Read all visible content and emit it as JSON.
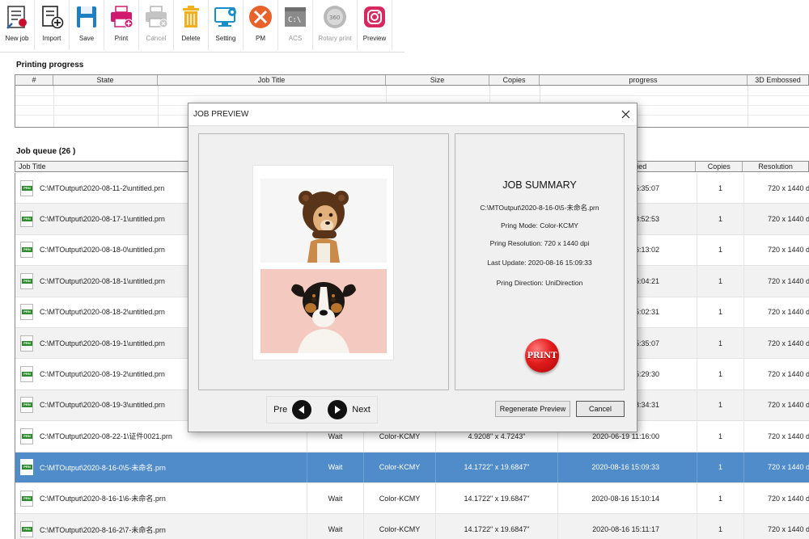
{
  "toolbar": {
    "buttons": [
      {
        "label": "New job",
        "icon": "new-job-icon"
      },
      {
        "label": "Import",
        "icon": "import-icon"
      },
      {
        "label": "Save",
        "icon": "save-icon"
      },
      {
        "label": "Print",
        "icon": "print-icon"
      },
      {
        "label": "Cancel",
        "icon": "cancel-print-icon",
        "disabled": true
      },
      {
        "label": "Delete",
        "icon": "delete-icon"
      },
      {
        "label": "Setting",
        "icon": "setting-icon"
      },
      {
        "label": "PM",
        "icon": "pm-tools-icon"
      },
      {
        "label": "ACS",
        "icon": "acs-icon",
        "disabled": true
      },
      {
        "label": "Rotary print",
        "icon": "rotary-print-icon",
        "disabled": true
      },
      {
        "label": "Preview",
        "icon": "preview-icon"
      }
    ]
  },
  "progress": {
    "title": "Printing progress",
    "columns": [
      "#",
      "State",
      "Job Title",
      "Size",
      "Copies",
      "progress",
      "3D Embossed"
    ]
  },
  "queue": {
    "title": "Job queue (26 )",
    "columns": [
      "Job Title",
      "",
      "",
      "",
      "ified",
      "Copies",
      "Resolution"
    ],
    "rows": [
      {
        "title": "C:\\MTOutput\\2020-08-11-2\\untitled.prn",
        "state": "",
        "mode": "",
        "size": "",
        "modified": "5:35:07",
        "copies": "1",
        "resolution": "720 x 1440 d"
      },
      {
        "title": "C:\\MTOutput\\2020-08-17-1\\untitled.prn",
        "state": "",
        "mode": "",
        "size": "",
        "modified": "8:52:53",
        "copies": "1",
        "resolution": "720 x 1440 d"
      },
      {
        "title": "C:\\MTOutput\\2020-08-18-0\\untitled.prn",
        "state": "",
        "mode": "",
        "size": "",
        "modified": "6:13:02",
        "copies": "1",
        "resolution": "720 x 1440 d"
      },
      {
        "title": "C:\\MTOutput\\2020-08-18-1\\untitled.prn",
        "state": "",
        "mode": "",
        "size": "",
        "modified": "5:04:21",
        "copies": "1",
        "resolution": "720 x 1440 d"
      },
      {
        "title": "C:\\MTOutput\\2020-08-18-2\\untitled.prn",
        "state": "",
        "mode": "",
        "size": "",
        "modified": "5:02:31",
        "copies": "1",
        "resolution": "720 x 1440 d"
      },
      {
        "title": "C:\\MTOutput\\2020-08-19-1\\untitled.prn",
        "state": "",
        "mode": "",
        "size": "",
        "modified": "5:35:07",
        "copies": "1",
        "resolution": "720 x 1440 d"
      },
      {
        "title": "C:\\MTOutput\\2020-08-19-2\\untitled.prn",
        "state": "",
        "mode": "",
        "size": "",
        "modified": "5:29:30",
        "copies": "1",
        "resolution": "720 x 1440 d"
      },
      {
        "title": "C:\\MTOutput\\2020-08-19-3\\untitled.prn",
        "state": "",
        "mode": "",
        "size": "",
        "modified": "8:34:31",
        "copies": "1",
        "resolution": "720 x 1440 d"
      },
      {
        "title": "C:\\MTOutput\\2020-08-22-1\\证件0021.prn",
        "state": "Wait",
        "mode": "Color-KCMY",
        "size": "4.9208\" x 4.7243\"",
        "modified": "2020-06-19 11:16:00",
        "copies": "1",
        "resolution": "720 x 1440 d"
      },
      {
        "title": "C:\\MTOutput\\2020-8-16-0\\5-未命名.prn",
        "state": "Wait",
        "mode": "Color-KCMY",
        "size": "14.1722\" x 19.6847\"",
        "modified": "2020-08-16 15:09:33",
        "copies": "1",
        "resolution": "720 x 1440 d",
        "selected": true
      },
      {
        "title": "C:\\MTOutput\\2020-8-16-1\\6-未命名.prn",
        "state": "Wait",
        "mode": "Color-KCMY",
        "size": "14.1722\" x 19.6847\"",
        "modified": "2020-08-16 15:10:14",
        "copies": "1",
        "resolution": "720 x 1440 d"
      },
      {
        "title": "C:\\MTOutput\\2020-8-16-2\\7-未命名.prn",
        "state": "Wait",
        "mode": "Color-KCMY",
        "size": "14.1722\" x 19.6847\"",
        "modified": "2020-08-16 15:11:17",
        "copies": "1",
        "resolution": "720 x 1440 d"
      }
    ]
  },
  "modal": {
    "title": "JOB PREVIEW",
    "summary_title": "JOB SUMMARY",
    "file_path": "C:\\MTOutput\\2020-8-16-0\\5-未命名.prn",
    "mode": "Pring Mode: Color-KCMY",
    "resolution": "Pring Resolution: 720 x 1440 dpi",
    "last_update": "Last Update: 2020-08-16 15:09:33",
    "direction": "Pring Direction: UniDirection",
    "print_label": "PRINT",
    "pre_label": "Pre",
    "next_label": "Next",
    "regenerate_label": "Regenerate Preview",
    "cancel_label": "Cancel"
  },
  "colors": {
    "selected_row": "#4f8cc9",
    "print_button": "#e41c1c",
    "file_tag": "#2e8b2e"
  }
}
